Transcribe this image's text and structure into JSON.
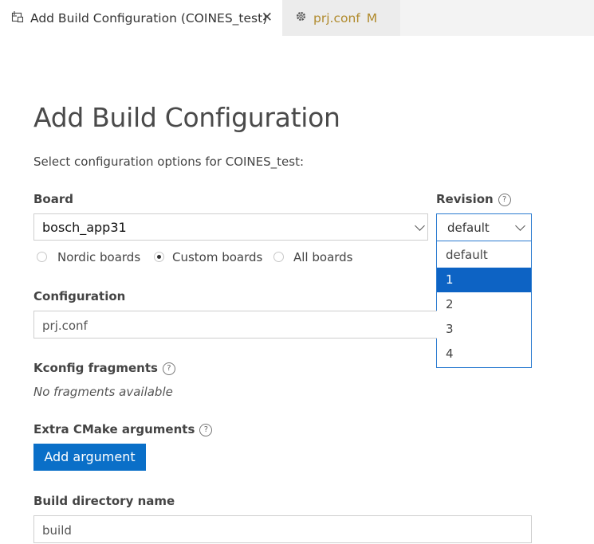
{
  "tabs": [
    {
      "label": "Add Build Configuration (COINES_test)",
      "icon": "build-config-icon",
      "close": "✕",
      "active": true
    },
    {
      "label": "prj.conf",
      "icon": "gear-icon",
      "modified": "M",
      "active": false
    }
  ],
  "page": {
    "title": "Add Build Configuration",
    "subtitle": "Select configuration options for COINES_test:"
  },
  "board": {
    "label": "Board",
    "value": "bosch_app31",
    "radios": [
      {
        "label": "Nordic boards",
        "checked": false
      },
      {
        "label": "Custom boards",
        "checked": true
      },
      {
        "label": "All boards",
        "checked": false
      }
    ]
  },
  "revision": {
    "label": "Revision",
    "value": "default",
    "options": [
      "default",
      "1",
      "2",
      "3",
      "4"
    ],
    "highlighted": "1"
  },
  "configuration": {
    "label": "Configuration",
    "value": "prj.conf"
  },
  "kconfig": {
    "label": "Kconfig fragments",
    "empty_text": "No fragments available"
  },
  "cmake": {
    "label": "Extra CMake arguments",
    "button_label": "Add argument"
  },
  "build_dir": {
    "label": "Build directory name",
    "value": "build"
  },
  "help_glyph": "?",
  "colors": {
    "accent": "#0a6fc8",
    "selected": "#0d63c4",
    "focus_border": "#2b7bd0",
    "modified": "#b08a2c"
  }
}
